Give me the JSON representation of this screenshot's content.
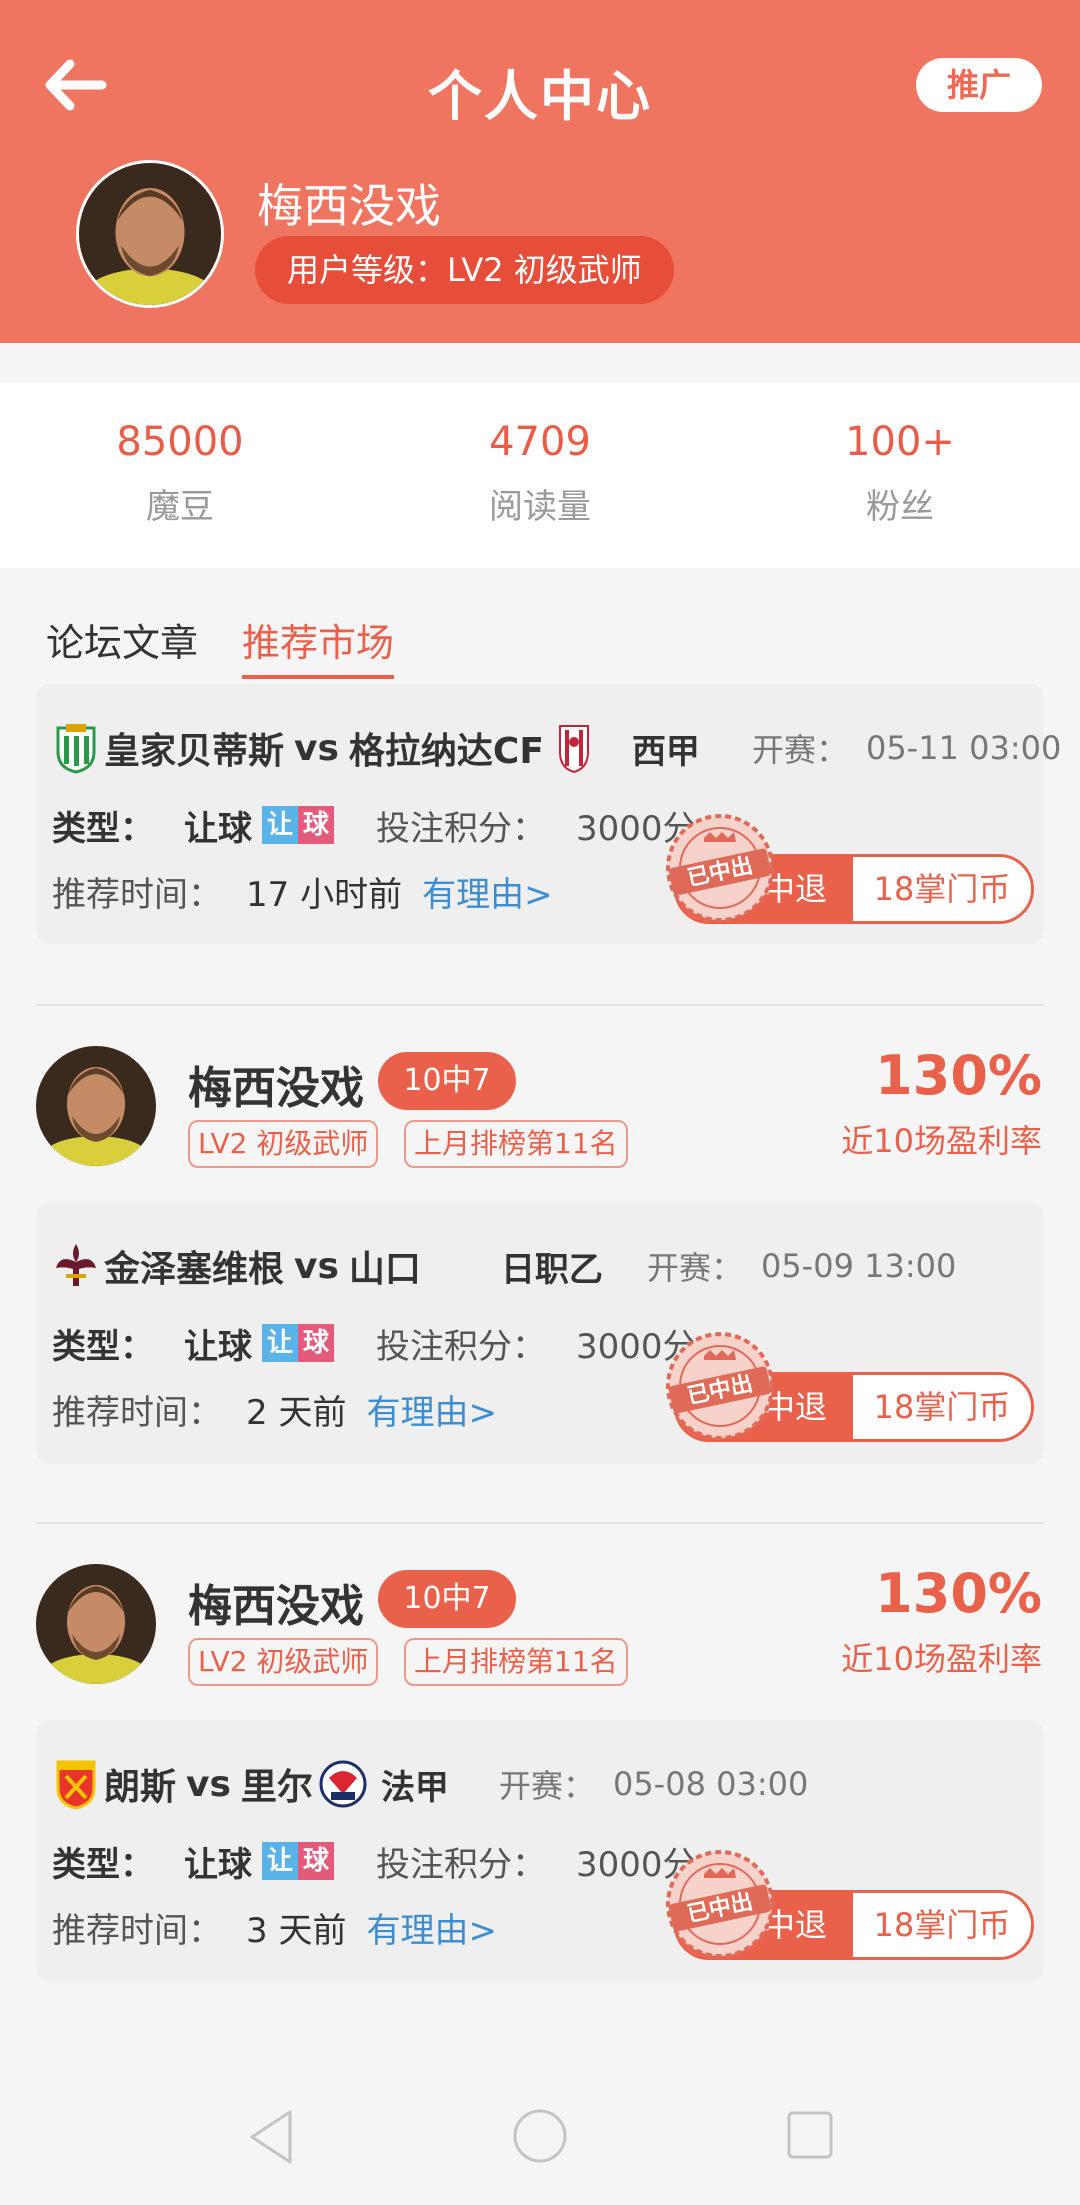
{
  "header": {
    "title": "个人中心",
    "promo_label": "推广",
    "user_name": "梅西没戏",
    "level_text": "用户等级：LV2 初级武师"
  },
  "stats": [
    {
      "value": "85000",
      "label": "魔豆"
    },
    {
      "value": "4709",
      "label": "阅读量"
    },
    {
      "value": "100+",
      "label": "粉丝"
    }
  ],
  "tabs": [
    {
      "label": "论坛文章"
    },
    {
      "label": "推荐市场"
    }
  ],
  "active_tab": "推荐市场",
  "recommendations": [
    {
      "author": null,
      "home": "皇家贝蒂斯",
      "vs": "vs",
      "away": "格拉纳达CF",
      "league": "西甲",
      "start_label": "开赛：",
      "start_time": "05-11 03:00",
      "type_label": "类型：",
      "type_value": "让球",
      "type_icon": [
        "让",
        "球"
      ],
      "points_label": "投注积分：",
      "points_value": "3000分",
      "time_label": "推荐时间：",
      "time_value": "17 小时前",
      "reason_link": "有理由>",
      "refund_label": "不中退",
      "price_label": "18掌门币",
      "stamp_text": "已中出"
    },
    {
      "author": {
        "name": "梅西没戏",
        "hit": "10中7",
        "tags": [
          "LV2 初级武师",
          "上月排榜第11名"
        ],
        "profit": "130%",
        "profit_label": "近10场盈利率"
      },
      "home": "金泽塞维根",
      "vs": "vs",
      "away": "山口",
      "league": "日职乙",
      "start_label": "开赛：",
      "start_time": "05-09 13:00",
      "type_label": "类型：",
      "type_value": "让球",
      "type_icon": [
        "让",
        "球"
      ],
      "points_label": "投注积分：",
      "points_value": "3000分",
      "time_label": "推荐时间：",
      "time_value": "2 天前",
      "reason_link": "有理由>",
      "refund_label": "不中退",
      "price_label": "18掌门币",
      "stamp_text": "已中出"
    },
    {
      "author": {
        "name": "梅西没戏",
        "hit": "10中7",
        "tags": [
          "LV2 初级武师",
          "上月排榜第11名"
        ],
        "profit": "130%",
        "profit_label": "近10场盈利率"
      },
      "home": "朗斯",
      "vs": "vs",
      "away": "里尔",
      "league": "法甲",
      "start_label": "开赛：",
      "start_time": "05-08 03:00",
      "type_label": "类型：",
      "type_value": "让球",
      "type_icon": [
        "让",
        "球"
      ],
      "points_label": "投注积分：",
      "points_value": "3000分",
      "time_label": "推荐时间：",
      "time_value": "3 天前",
      "reason_link": "有理由>",
      "refund_label": "不中退",
      "price_label": "18掌门币",
      "stamp_text": "已中出"
    }
  ],
  "colors": {
    "header_bg": "#ef7561",
    "accent": "#e9604b",
    "level_pill": "#e64e3a",
    "link": "#3c8ed0"
  },
  "icons": [
    "back-arrow-icon",
    "nav-back-icon",
    "nav-home-icon",
    "nav-recent-icon"
  ]
}
